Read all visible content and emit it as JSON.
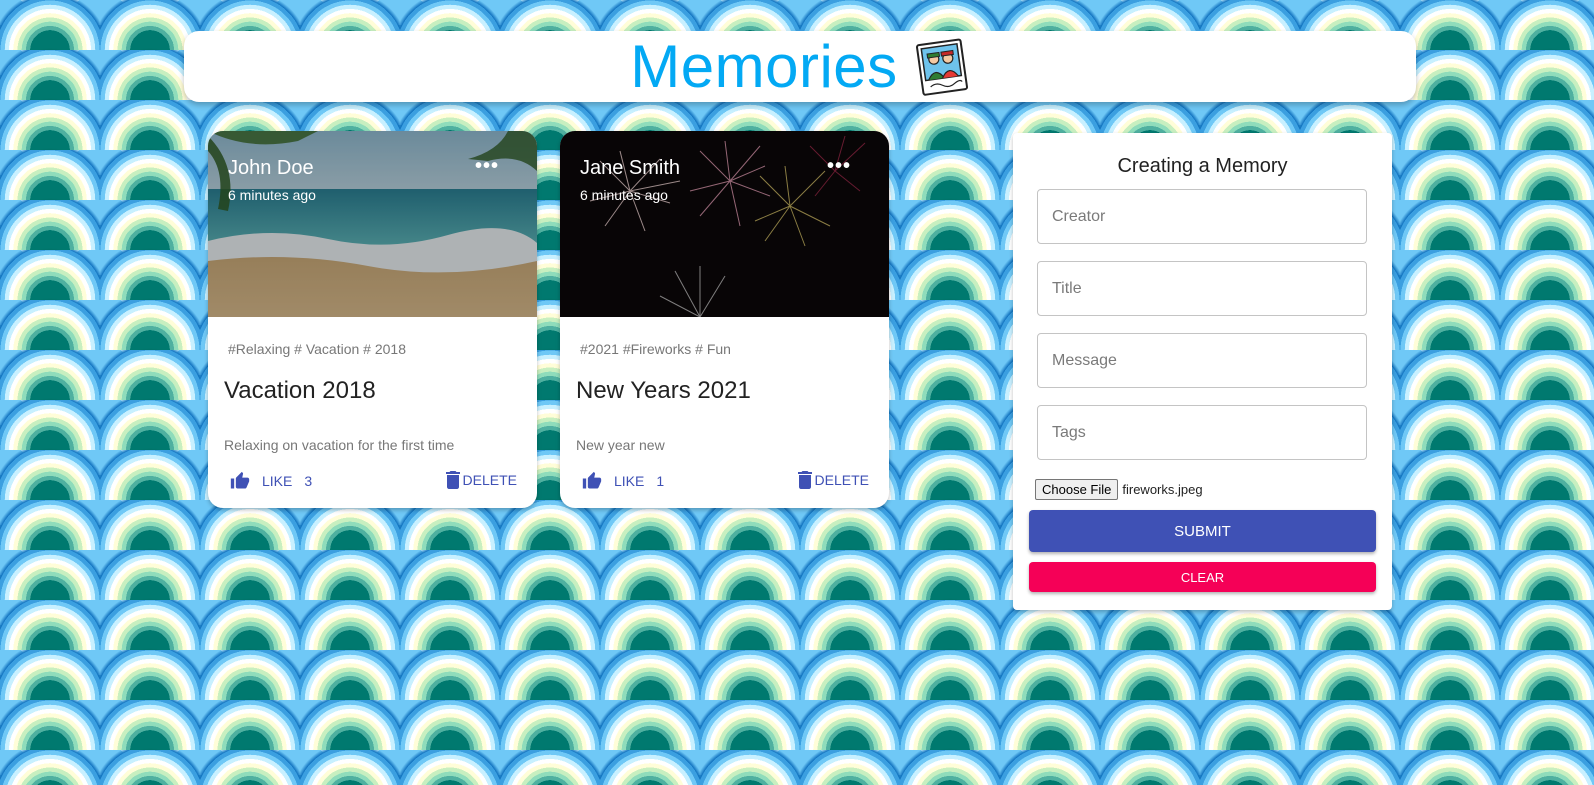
{
  "colors": {
    "brand": "#03a9f4",
    "primary": "#3f51b5",
    "secondary": "#f50057"
  },
  "header": {
    "title": "Memories",
    "logo_icon": "memories-photo-logo-icon"
  },
  "posts": [
    {
      "creator": "John Doe",
      "time_ago": "6 minutes ago",
      "more_icon": "more-horiz-icon",
      "tags": "#Relaxing # Vacation # 2018",
      "title": "Vacation 2018",
      "message": "Relaxing on vacation for the first time",
      "like_label": "LIKE",
      "like_count": "3",
      "delete_label": "DELETE",
      "image": "beach-photo"
    },
    {
      "creator": "Jane Smith",
      "time_ago": "6 minutes ago",
      "more_icon": "more-horiz-icon",
      "tags": "#2021 #Fireworks # Fun",
      "title": "New Years 2021",
      "message": "New year new",
      "like_label": "LIKE",
      "like_count": "1",
      "delete_label": "DELETE",
      "image": "fireworks-photo"
    }
  ],
  "form": {
    "title": "Creating a Memory",
    "creator_placeholder": "Creator",
    "title_placeholder": "Title",
    "message_placeholder": "Message",
    "tags_placeholder": "Tags",
    "file_button_label": "Choose File",
    "file_name": "fireworks.jpeg",
    "submit_label": "SUBMIT",
    "clear_label": "CLEAR"
  }
}
